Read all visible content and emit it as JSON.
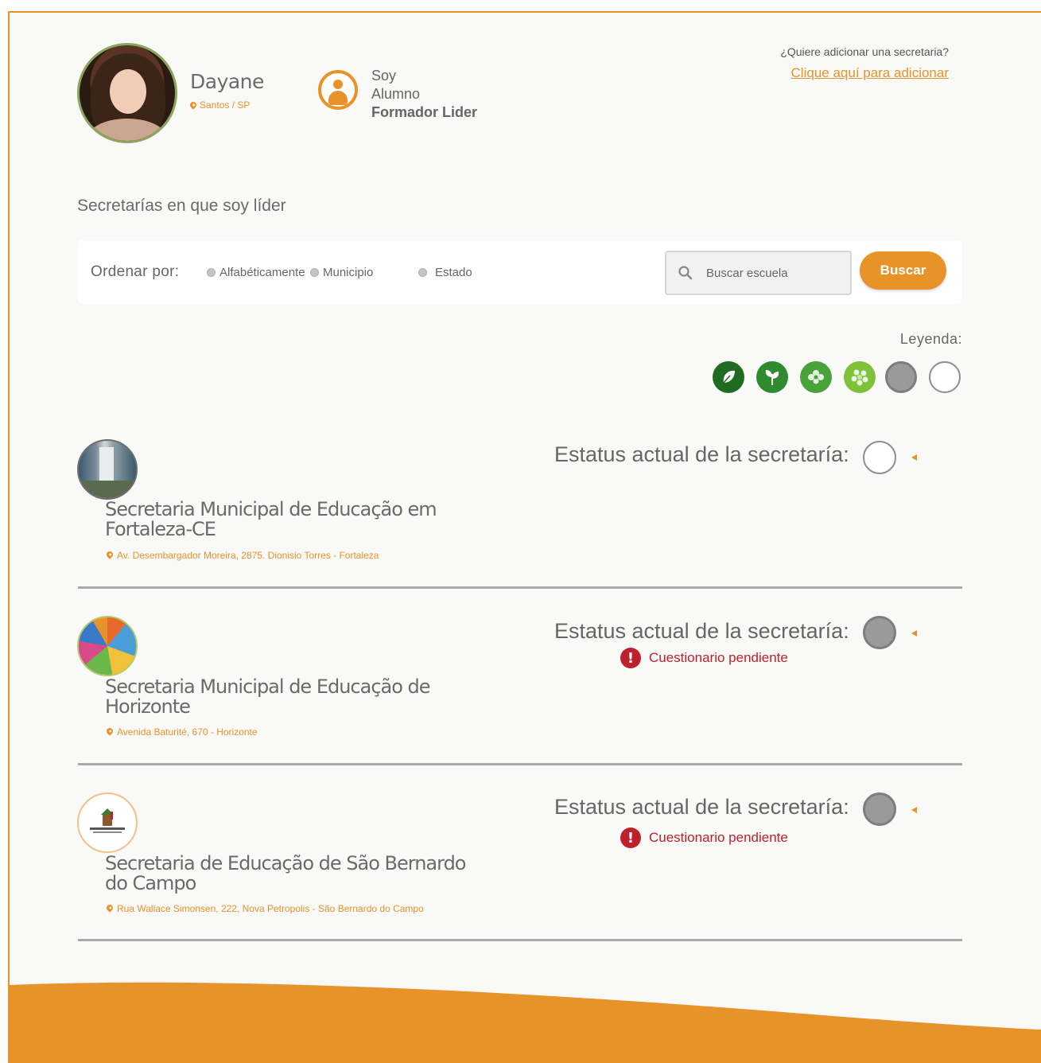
{
  "profile": {
    "name": "Dayane",
    "location": "Santos / SP"
  },
  "role": {
    "line1": "Soy",
    "line2": "Alumno",
    "line3": "Formador Lider"
  },
  "add_secretaria": {
    "question": "¿Quiere adicionar una secretaria?",
    "link": "Clique aquí para adicionar"
  },
  "section_title": "Secretarías en que soy líder",
  "filter": {
    "order_label": "Ordenar por:",
    "options": [
      "Alfabéticamente",
      "Municipio",
      "Estado"
    ],
    "search_placeholder": "Buscar escuela",
    "search_value": "",
    "search_button": "Buscar"
  },
  "legend": {
    "label": "Leyenda:",
    "colors": [
      "#1f6b22",
      "#2e8b2e",
      "#4aa33a",
      "#7ec23a",
      "#9a9a9a",
      "#ffffff"
    ],
    "icons": [
      "leaf-icon",
      "sprout-icon",
      "tree-icon",
      "bush-icon",
      "gray-circle-icon",
      "empty-circle-icon"
    ]
  },
  "secretarias": [
    {
      "title": "Secretaria Municipal de Educação em Fortaleza-CE",
      "address": "Av. Desembargador Moreira, 2875. Dionisio Torres - Fortaleza",
      "status_label": "Estatus actual de la secretaría:",
      "status_color": "#ffffff",
      "pending": ""
    },
    {
      "title": "Secretaria Municipal de Educação de Horizonte",
      "address": "Avenida Baturité, 670 - Horizonte",
      "status_label": "Estatus actual de la secretaría:",
      "status_color": "#9a9a9a",
      "pending": "Cuestionario pendiente"
    },
    {
      "title": "Secretaria de Educação de São Bernardo do Campo",
      "address": "Rua Wallace Simonsen, 222, Nova Petropolis - São Bernardo do Campo",
      "status_label": "Estatus actual de la secretaría:",
      "status_color": "#9a9a9a",
      "pending": "Cuestionario pendiente"
    }
  ],
  "colors": {
    "accent": "#e8922a",
    "alert": "#c0202a"
  }
}
